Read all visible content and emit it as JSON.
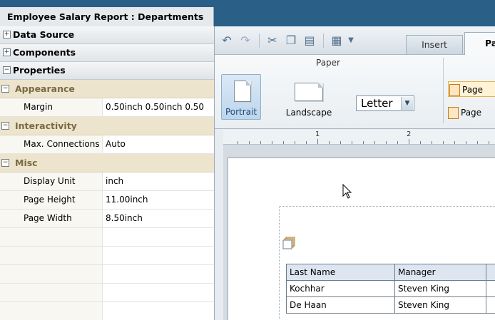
{
  "report_tab": {
    "title": "Employee Salary Report : Departments"
  },
  "left_panel": {
    "accordions": [
      {
        "label": "Data Source",
        "toggle": "+"
      },
      {
        "label": "Components",
        "toggle": "+"
      },
      {
        "label": "Properties",
        "toggle": "−"
      }
    ],
    "groups": [
      {
        "label": "Appearance",
        "toggle": "−",
        "rows": [
          {
            "name": "Margin",
            "value": "0.50inch 0.50inch 0.50"
          }
        ]
      },
      {
        "label": "Interactivity",
        "toggle": "−",
        "rows": [
          {
            "name": "Max. Connections",
            "value": "Auto"
          }
        ]
      },
      {
        "label": "Misc",
        "toggle": "−",
        "rows": [
          {
            "name": "Display Unit",
            "value": "inch"
          },
          {
            "name": "Page Height",
            "value": "11.00inch"
          },
          {
            "name": "Page Width",
            "value": "8.50inch"
          }
        ]
      }
    ]
  },
  "toolbar": {
    "tabs": {
      "insert": "Insert",
      "page": "Page"
    }
  },
  "ribbon": {
    "paper_group_label": "Paper",
    "portrait_label": "Portrait",
    "landscape_label": "Landscape",
    "paper_size": "Letter",
    "page_option_1": "Page",
    "page_option_2": "Page"
  },
  "ruler": {
    "labels": [
      "1",
      "2"
    ]
  },
  "table": {
    "headers": [
      "Last Name",
      "Manager",
      ""
    ],
    "rows": [
      [
        "Kochhar",
        "Steven King",
        ""
      ],
      [
        "De Haan",
        "Steven King",
        ""
      ]
    ]
  },
  "colors": {
    "title_bar": "#2a5f88",
    "group_header": "#ece4cc",
    "selected_button": "#bcd5ec"
  }
}
